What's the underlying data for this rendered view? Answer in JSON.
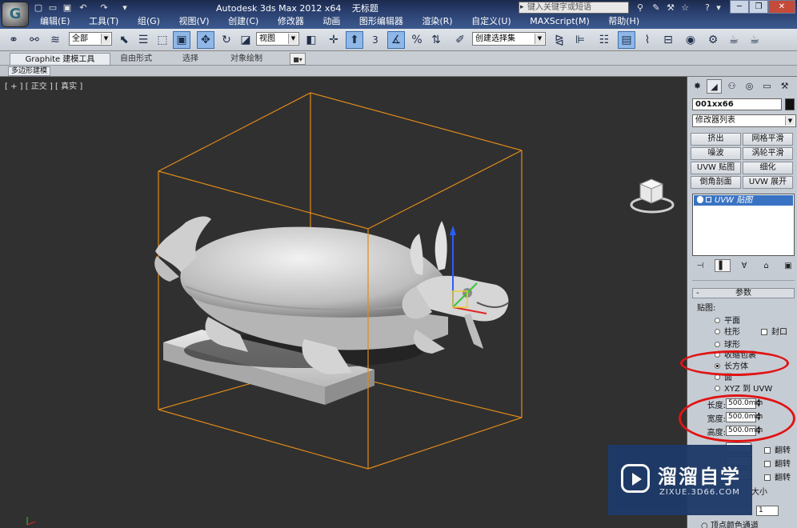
{
  "titlebar": {
    "app_title": "Autodesk 3ds Max  2012 x64",
    "doc_title": "无标题",
    "search_placeholder": "键入关键字或短语"
  },
  "menu": [
    "编辑(E)",
    "工具(T)",
    "组(G)",
    "视图(V)",
    "创建(C)",
    "修改器",
    "动画",
    "图形编辑器",
    "渲染(R)",
    "自定义(U)",
    "MAXScript(M)",
    "帮助(H)"
  ],
  "toolbar": {
    "selection_filter": "全部",
    "ref_coord": "视图",
    "named_selection": "创建选择集",
    "snap_label": "3",
    "percent_snap": "%"
  },
  "ribbon": {
    "tabs": [
      "Graphite 建模工具",
      "自由形式",
      "选择",
      "对象绘制"
    ],
    "subtab": "多边形建模"
  },
  "viewport": {
    "label": "[ + ] [ 正交 ] [ 真实 ]"
  },
  "command_panel": {
    "object_name": "001xx66",
    "modifier_list": "修改器列表",
    "modifier_buttons": [
      "挤出",
      "网格平滑",
      "噪波",
      "涡轮平滑",
      "UVW 贴图",
      "细化",
      "倒角剖面",
      "UVW 展开"
    ],
    "stack_item": "UVW 贴图",
    "params_rollout": "参数",
    "mapping_label": "贴图:",
    "mapping_options": [
      "平面",
      "柱形",
      "球形",
      "收缩包裹",
      "长方体",
      "面",
      "XYZ 到 UVW"
    ],
    "selected_mapping": "长方体",
    "cap_label": "封口",
    "length_label": "长度:",
    "length_value": "500.0mm",
    "width_label": "宽度:",
    "width_value": "500.0mm",
    "height_label": "高度:",
    "height_value": "500.0mm",
    "flip_label": "翻转",
    "real_world_size": "大小",
    "map_channel_value": "1",
    "vertex_color_channel": "顶点颜色通道"
  },
  "watermark": {
    "title": "溜溜自学",
    "url": "ZIXUE.3D66.COM"
  },
  "colors": {
    "bounding_box": "#e08a1a",
    "annotation": "#e01414",
    "viewport_bg": "#303030"
  }
}
